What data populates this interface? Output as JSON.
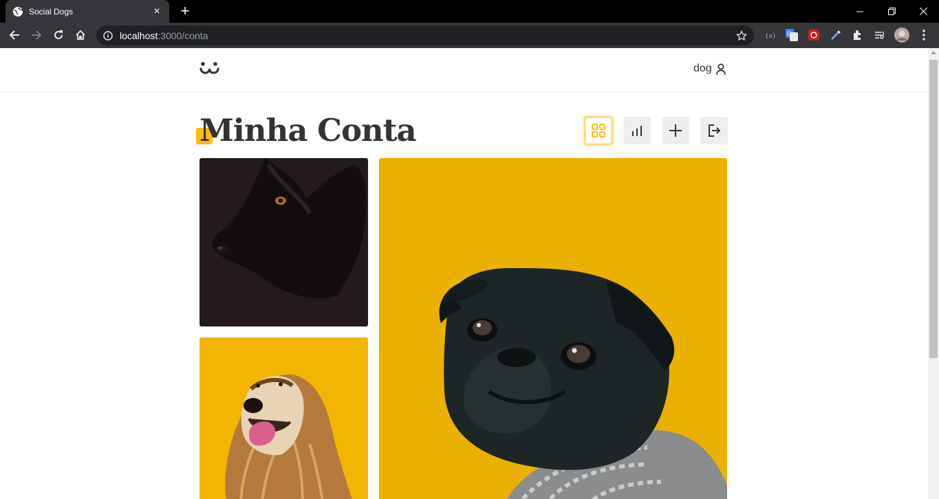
{
  "browser": {
    "tab_title": "Social Dogs",
    "url_host": "localhost",
    "url_rest": ":3000/conta",
    "icons": [
      "globe-icon",
      "close-icon",
      "plus-icon",
      "back-icon",
      "forward-icon",
      "reload-icon",
      "home-icon",
      "info-icon",
      "star-icon",
      "puzzle-icon"
    ]
  },
  "header": {
    "logo": "dog-logo-icon",
    "login_label": "dog"
  },
  "main": {
    "title": "Minha Conta",
    "nav_buttons": [
      {
        "name": "feed-grid",
        "icon": "grid-icon",
        "active": true
      },
      {
        "name": "statistics",
        "icon": "bar-chart-icon",
        "active": false
      },
      {
        "name": "post-photo",
        "icon": "plus-icon",
        "active": false
      },
      {
        "name": "logout",
        "icon": "logout-icon",
        "active": false
      }
    ],
    "photos": [
      {
        "name": "black-dog-photo",
        "background": "#231a1b"
      },
      {
        "name": "pug-photo",
        "background": "#eab100"
      },
      {
        "name": "afghan-hound-photo",
        "background": "#f3b500"
      }
    ]
  },
  "colors": {
    "accent": "#ffbb11",
    "text": "#333333"
  }
}
